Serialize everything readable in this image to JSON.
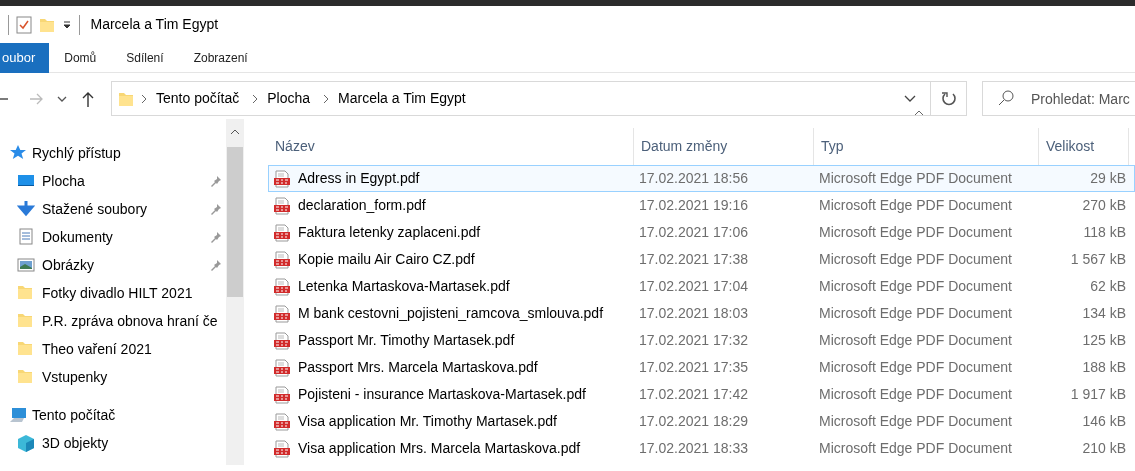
{
  "window": {
    "title": "Marcela a Tim Egypt"
  },
  "ribbon_tabs": [
    {
      "label": "oubor",
      "selected": true
    },
    {
      "label": "Domů",
      "selected": false
    },
    {
      "label": "Sdílení",
      "selected": false
    },
    {
      "label": "Zobrazení",
      "selected": false
    }
  ],
  "address_bar": {
    "breadcrumbs": [
      "Tento počítač",
      "Plocha",
      "Marcela a Tim Egypt"
    ]
  },
  "search": {
    "placeholder": "Prohledat: Marc"
  },
  "sidebar": {
    "items": [
      {
        "label": "Rychlý přístup",
        "kind": "star",
        "children": [
          {
            "label": "Plocha",
            "kind": "desktop",
            "pinned": true
          },
          {
            "label": "Stažené soubory",
            "kind": "download",
            "pinned": true
          },
          {
            "label": "Dokumenty",
            "kind": "document",
            "pinned": true
          },
          {
            "label": "Obrázky",
            "kind": "picture",
            "pinned": true
          },
          {
            "label": "Fotky divadlo HILT 2021",
            "kind": "folder",
            "pinned": false
          },
          {
            "label": "P.R. zpráva obnova hraní če",
            "kind": "folder",
            "pinned": false
          },
          {
            "label": "Theo vaření 2021",
            "kind": "folder",
            "pinned": false
          },
          {
            "label": "Vstupenky",
            "kind": "folder",
            "pinned": false
          }
        ]
      },
      {
        "label": "Tento počítač",
        "kind": "computer",
        "children": [
          {
            "label": "3D objekty",
            "kind": "cube",
            "pinned": false
          }
        ]
      }
    ]
  },
  "table": {
    "columns": [
      {
        "label": "Název",
        "sorted": false
      },
      {
        "label": "Datum změny",
        "sorted": false
      },
      {
        "label": "Typ",
        "sorted": true
      },
      {
        "label": "Velikost",
        "sorted": false
      }
    ],
    "rows": [
      {
        "name": "Adress in Egypt.pdf",
        "date": "17.02.2021 18:56",
        "type": "Microsoft Edge PDF Document",
        "size": "29 kB",
        "selected": true
      },
      {
        "name": "declaration_form.pdf",
        "date": "17.02.2021 19:16",
        "type": "Microsoft Edge PDF Document",
        "size": "270 kB",
        "selected": false
      },
      {
        "name": "Faktura letenky zaplaceni.pdf",
        "date": "17.02.2021 17:06",
        "type": "Microsoft Edge PDF Document",
        "size": "118 kB",
        "selected": false
      },
      {
        "name": "Kopie mailu Air Cairo CZ.pdf",
        "date": "17.02.2021 17:38",
        "type": "Microsoft Edge PDF Document",
        "size": "1 567 kB",
        "selected": false
      },
      {
        "name": "Letenka Martaskova-Martasek.pdf",
        "date": "17.02.2021 17:04",
        "type": "Microsoft Edge PDF Document",
        "size": "62 kB",
        "selected": false
      },
      {
        "name": "M bank cestovni_pojisteni_ramcova_smlouva.pdf",
        "date": "17.02.2021 18:03",
        "type": "Microsoft Edge PDF Document",
        "size": "134 kB",
        "selected": false
      },
      {
        "name": "Passport Mr. Timothy Martasek.pdf",
        "date": "17.02.2021 17:32",
        "type": "Microsoft Edge PDF Document",
        "size": "125 kB",
        "selected": false
      },
      {
        "name": "Passport Mrs. Marcela Martaskova.pdf",
        "date": "17.02.2021 17:35",
        "type": "Microsoft Edge PDF Document",
        "size": "188 kB",
        "selected": false
      },
      {
        "name": "Pojisteni - insurance Martaskova-Martasek.pdf",
        "date": "17.02.2021 17:42",
        "type": "Microsoft Edge PDF Document",
        "size": "1 917 kB",
        "selected": false
      },
      {
        "name": "Visa application Mr. Timothy Martasek.pdf",
        "date": "17.02.2021 18:29",
        "type": "Microsoft Edge PDF Document",
        "size": "146 kB",
        "selected": false
      },
      {
        "name": "Visa application Mrs. Marcela Martaskova.pdf",
        "date": "17.02.2021 18:33",
        "type": "Microsoft Edge PDF Document",
        "size": "210 kB",
        "selected": false
      }
    ]
  }
}
